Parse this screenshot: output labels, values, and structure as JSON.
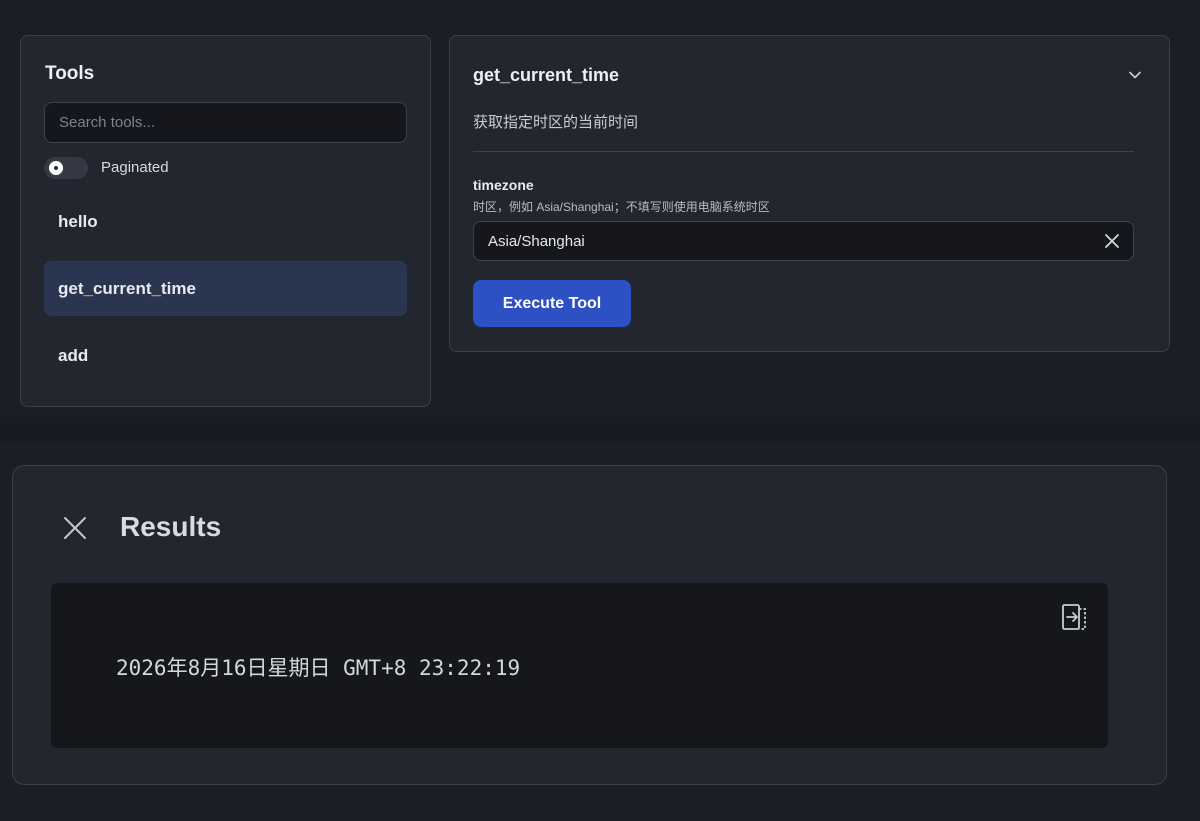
{
  "colors": {
    "accent": "#2d50c4",
    "active_item_bg": "#2a3550",
    "panel_bg": "#22262f",
    "page_bg": "#1b1e26"
  },
  "tools": {
    "title": "Tools",
    "search_placeholder": "Search tools...",
    "paginated_label": "Paginated",
    "paginated_on": true,
    "items": [
      {
        "label": "hello",
        "active": false
      },
      {
        "label": "get_current_time",
        "active": true
      },
      {
        "label": "add",
        "active": false
      }
    ]
  },
  "detail": {
    "title": "get_current_time",
    "collapse_icon": "chevron-down-icon",
    "description": "获取指定时区的当前时间",
    "param": {
      "name": "timezone",
      "hint": "时区，例如 Asia/Shanghai；不填写则使用电脑系统时区",
      "value": "Asia/Shanghai",
      "clear_icon": "close-icon"
    },
    "execute_label": "Execute Tool"
  },
  "results": {
    "close_icon": "close-icon",
    "title": "Results",
    "copy_icon": "copy-icon",
    "output": "2026年8月16日星期日 GMT+8 23:22:19"
  }
}
